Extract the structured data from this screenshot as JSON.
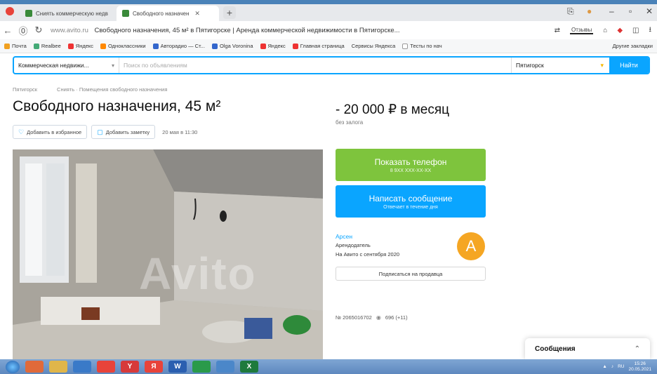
{
  "browser": {
    "tabs": [
      {
        "label": "Сниять коммерческую недв",
        "active": false
      },
      {
        "label": "Свободного назначен",
        "active": true
      }
    ],
    "new_tab_label": "+",
    "url_domain": "www.avito.ru",
    "url_title": "Свободного назначения, 45 м² в Пятигорске | Аренда коммерческой недвижимости в Пятигорске...",
    "reviews_badge": "Отзывы",
    "bookmarks": [
      "Почта",
      "Realbee",
      "Яндекс",
      "Одноклассники",
      "Авторадио — Ст...",
      "Olga Voronina",
      "Яндекс",
      "Главная страница",
      "Сервисы Яндекса",
      "Тесты по нач",
      "Другие закладки"
    ]
  },
  "search": {
    "category": "Коммерческая недвижи...",
    "placeholder": "Поиск по объявлениям",
    "city": "Пятигорск",
    "find_label": "Найти"
  },
  "breadcrumb": [
    "Пятигорск",
    "Сниять · Помещения свободного назначения"
  ],
  "listing": {
    "title": "Свободного назначения, 45 м²",
    "price": "- 20 000 ₽ в месяц",
    "deposit": "без залога",
    "add_favorite": "Добавить в избранное",
    "add_note": "Добавить заметку",
    "posted": "20 мая в 11:30",
    "photo_watermark": "Avito",
    "number": "№ 2065016702",
    "views": "696 (+11)"
  },
  "contact": {
    "show_phone": "Показать телефон",
    "phone_masked": "8 9XX XXX-XX-XX",
    "write_message": "Написать сообщение",
    "write_sub": "Отвечает в течение дня",
    "seller_name": "Арсен",
    "seller_role": "Арендодатель",
    "seller_since": "На Авито с сентября 2020",
    "avatar_letter": "А",
    "subscribe": "Подписаться на продавца"
  },
  "messages": {
    "label": "Сообщения"
  },
  "taskbar": {
    "apps": [
      {
        "icon": "chrome-icon",
        "glyph": "",
        "color": "#e06a3a"
      },
      {
        "icon": "folder-icon",
        "glyph": "",
        "color": "#e0b64a"
      },
      {
        "icon": "media-icon",
        "glyph": "",
        "color": "#3a7ac8"
      },
      {
        "icon": "yandex-browser-icon",
        "glyph": "",
        "color": "#e8433a"
      },
      {
        "icon": "yandex-icon",
        "glyph": "Y",
        "color": "#d73a3a"
      },
      {
        "icon": "yandex-app-icon",
        "glyph": "Я",
        "color": "#e8433a"
      },
      {
        "icon": "word-icon",
        "glyph": "W",
        "color": "#2b5fb0"
      },
      {
        "icon": "green-app-icon",
        "glyph": "",
        "color": "#2a9a4a"
      },
      {
        "icon": "window-icon",
        "glyph": "",
        "color": "#4b87c9"
      },
      {
        "icon": "excel-icon",
        "glyph": "X",
        "color": "#1e7a3c"
      }
    ],
    "time": "15:26",
    "date": "20.05.2021"
  },
  "colors": {
    "accent_blue": "#0aa5ff",
    "phone_green": "#7ec43d",
    "avatar_orange": "#f5a623"
  }
}
